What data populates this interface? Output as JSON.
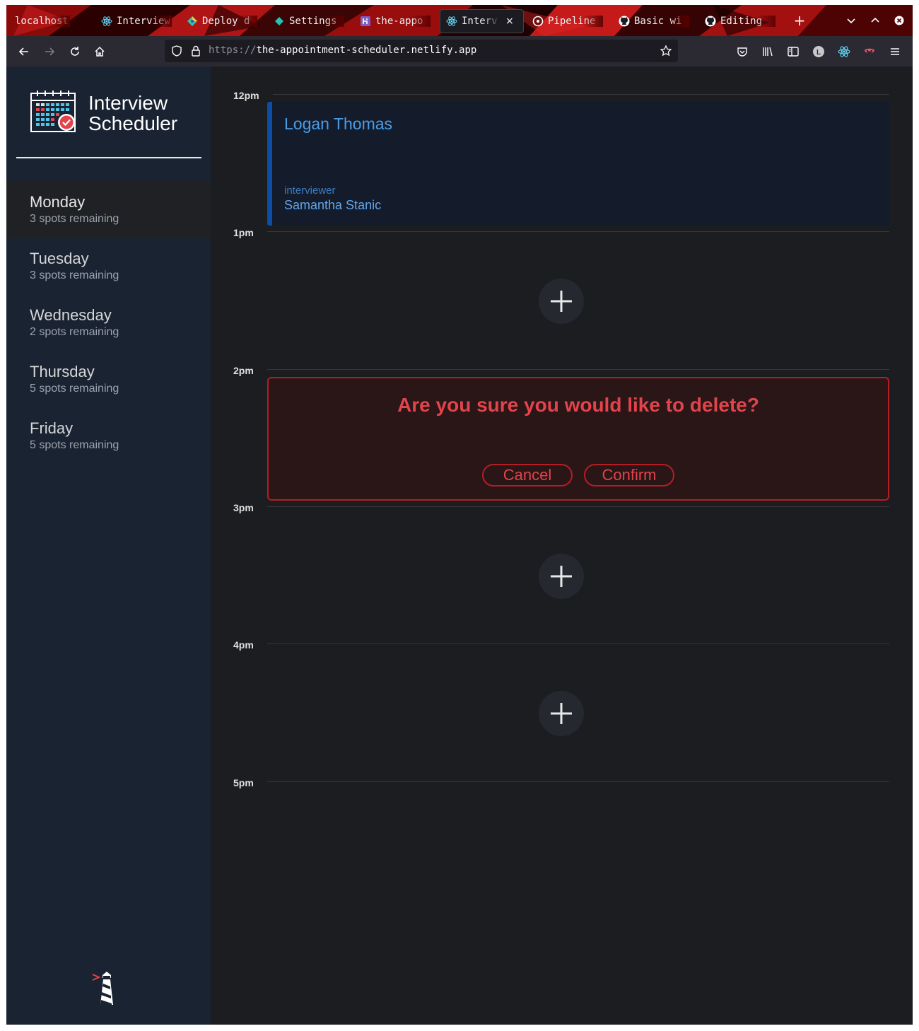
{
  "browser": {
    "tabs": [
      {
        "label": "localhost:",
        "icon": "none"
      },
      {
        "label": "Interview",
        "icon": "react-icon"
      },
      {
        "label": "Deploy d",
        "icon": "netlify-icon"
      },
      {
        "label": "Settings",
        "icon": "netlify-diamond-icon"
      },
      {
        "label": "the-appo",
        "icon": "heroku-icon"
      },
      {
        "label": "Interv",
        "icon": "react-icon"
      },
      {
        "label": "Pipeline",
        "icon": "circleci-icon"
      },
      {
        "label": "Basic wi",
        "icon": "github-icon"
      },
      {
        "label": "Editing",
        "icon": "github-icon"
      }
    ],
    "close_tab": "×",
    "new_tab": "+",
    "url_scheme": "https://",
    "url_host": "the-appointment-scheduler.netlify.app"
  },
  "sidebar": {
    "logo_line1": "Interview",
    "logo_line2": "Scheduler",
    "days": [
      {
        "name": "Monday",
        "spots": "3 spots remaining",
        "selected": true
      },
      {
        "name": "Tuesday",
        "spots": "3 spots remaining",
        "selected": false
      },
      {
        "name": "Wednesday",
        "spots": "2 spots remaining",
        "selected": false
      },
      {
        "name": "Thursday",
        "spots": "5 spots remaining",
        "selected": false
      },
      {
        "name": "Friday",
        "spots": "5 spots remaining",
        "selected": false
      }
    ]
  },
  "schedule": {
    "times": [
      "12pm",
      "1pm",
      "2pm",
      "3pm",
      "4pm",
      "5pm"
    ],
    "appointment": {
      "student": "Logan Thomas",
      "interviewer_label": "interviewer",
      "interviewer": "Samantha Stanic"
    },
    "confirm": {
      "message": "Are you sure you would like to delete?",
      "cancel": "Cancel",
      "confirm": "Confirm"
    },
    "add_symbol": "+"
  },
  "colors": {
    "accent_blue": "#4b9de6",
    "danger_red": "#e3434b",
    "sidebar_bg": "#1a2332"
  }
}
